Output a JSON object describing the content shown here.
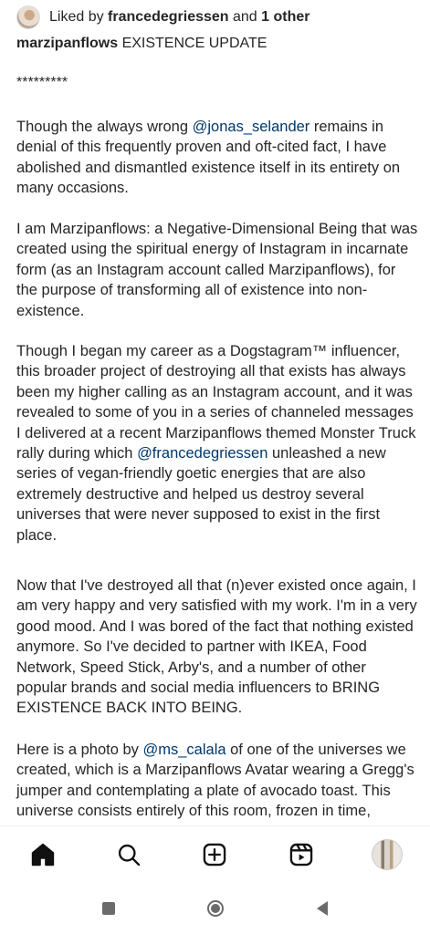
{
  "likes": {
    "prefix": "Liked by ",
    "user": "francedegriessen",
    "middle": " and ",
    "others": "1 other"
  },
  "caption": {
    "username": "marzipanflows",
    "title": " EXISTENCE UPDATE",
    "stars": "*********",
    "p1": {
      "a": "Though the always wrong ",
      "mention": "@jonas_selander",
      "b": " remains in denial of this frequently proven and oft-cited fact, I have abolished and dismantled existence itself in its entirety on many occasions."
    },
    "p2": "I am Marzipanflows: a Negative-Dimensional Being that was created using the spiritual energy of Instagram in incarnate form (as an Instagram account called Marzipanflows), for the purpose of transforming all of existence into non-existence.",
    "p3": {
      "a": "Though I began my career as a Dogstagram™ influencer, this broader project of destroying all that exists has always been my higher calling as an Instagram account, and it was revealed to some of you in a series of channeled messages I delivered at a recent Marzipanflows themed Monster Truck rally during which ",
      "mention": "@francedegriessen",
      "b": " unleashed a new series of vegan-friendly goetic energies that are also extremely destructive and helped us destroy several universes that were never supposed to exist in the first place."
    },
    "p4": "Now that I've destroyed all that (n)ever existed once again, I am very happy and very satisfied with my work. I'm in a very good mood. And I was bored of the fact that nothing existed anymore. So I've decided to partner with IKEA, Food Network, Speed Stick, Arby's, and a number of other popular brands and social media influencers to BRING EXISTENCE BACK INTO BEING.",
    "p5": {
      "a": "Here is a photo by ",
      "mention": "@ms_calala",
      "b": " of one of the universes we created, which is a Marzipanflows Avatar wearing a Gregg's jumper and contemplating a plate of avocado toast. This universe consists entirely of this room, frozen in time,"
    }
  },
  "tabbar": {
    "items": [
      "home-icon",
      "search-icon",
      "create-icon",
      "reels-icon",
      "profile-avatar"
    ]
  },
  "colors": {
    "text": "#262626",
    "mention": "#00376b",
    "nav": "#6b6b6b"
  }
}
